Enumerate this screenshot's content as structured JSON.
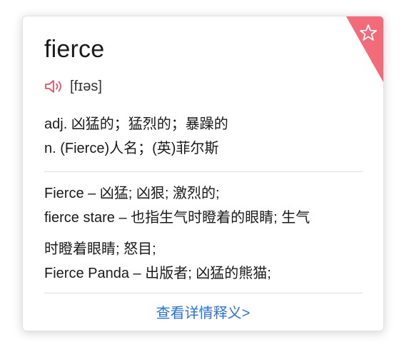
{
  "entry": {
    "word": "fierce",
    "phonetic": "[fɪəs]"
  },
  "definitions": [
    "adj. 凶猛的；猛烈的；暴躁的",
    "n. (Fierce)人名；(英)菲尔斯"
  ],
  "web_meanings": [
    "Fierce – 凶猛; 凶狠; 激烈的;",
    "fierce stare – 也指生气时瞪着的眼睛; 生气",
    "时瞪着眼睛; 怒目;",
    "Fierce Panda – 出版者; 凶猛的熊猫;"
  ],
  "more_link": "查看详情释义>",
  "icons": {
    "favorite": "star-icon",
    "pronounce": "speaker-icon"
  },
  "colors": {
    "corner": "#f26b78",
    "speaker": "#e0566a",
    "link": "#2b72d6"
  }
}
